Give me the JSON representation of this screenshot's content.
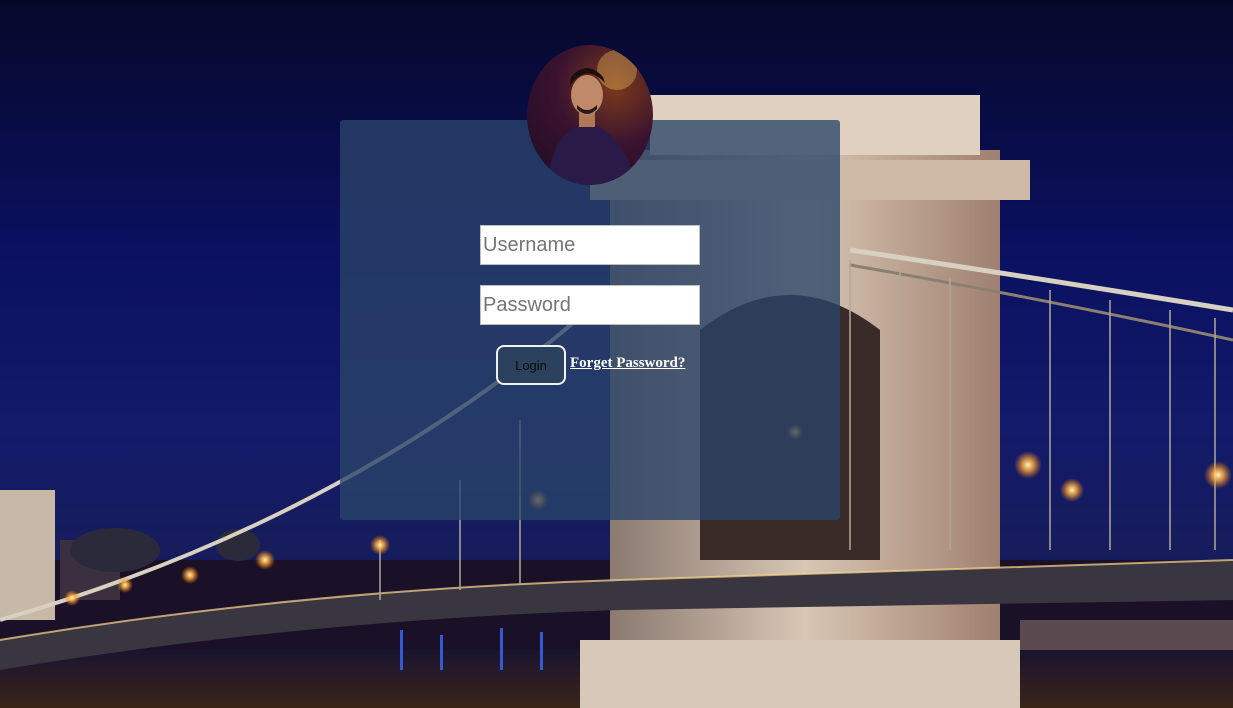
{
  "login_form": {
    "username_placeholder": "Username",
    "password_placeholder": "Password",
    "login_label": "Login",
    "forgot_password_label": "Forget Password?"
  },
  "colors": {
    "panel_overlay": "#2a4469",
    "login_button_bg": "#2b425e",
    "link_color": "#ffffff"
  },
  "icons": {
    "avatar": "profile-photo"
  }
}
